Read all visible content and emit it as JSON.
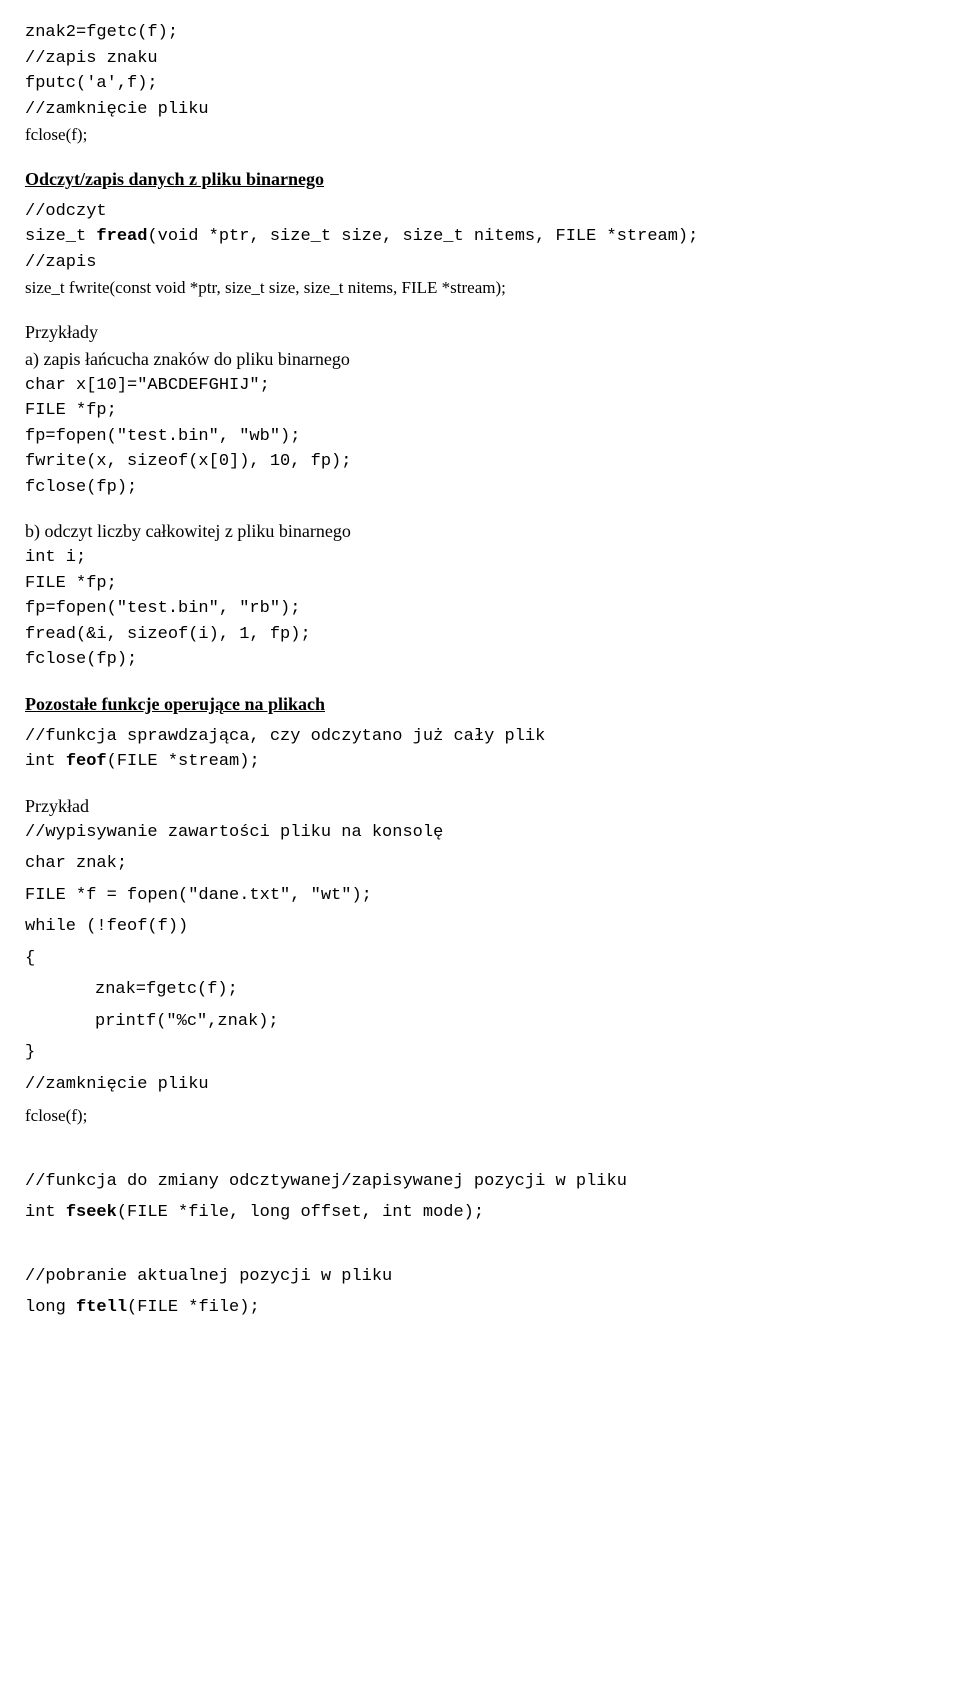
{
  "s1": {
    "l1": "znak2=fgetc(f);",
    "l2": "//zapis znaku",
    "l3": "fputc('a',f);",
    "l4": "//zamknięcie pliku",
    "l5": "fclose(f);"
  },
  "h1": "Odczyt/zapis danych z pliku binarnego",
  "s2": {
    "l1": "//odczyt",
    "l2": "size_t fread(void *ptr, size_t size, size_t nitems, FILE *stream);",
    "l3": "//zapis",
    "l4": "size_t fwrite(const void *ptr, size_t size, size_t nitems, FILE *stream);"
  },
  "ex_label": "Przykłady",
  "exa": {
    "title": "a) zapis łańcucha znaków do pliku binarnego",
    "l1": "char x[10]=\"ABCDEFGHIJ\";",
    "l2": "FILE *fp;",
    "l3": "fp=fopen(\"test.bin\", \"wb\");",
    "l4": "fwrite(x, sizeof(x[0]), 10, fp);",
    "l5": "fclose(fp);"
  },
  "exb": {
    "title": "b) odczyt liczby całkowitej z pliku binarnego",
    "l1": "int i;",
    "l2": "FILE *fp;",
    "l3": "fp=fopen(\"test.bin\", \"rb\");",
    "l4": "fread(&i, sizeof(i), 1, fp);",
    "l5": "fclose(fp);"
  },
  "h2": "Pozostałe funkcje operujące na plikach",
  "s3": {
    "l1": "//funkcja sprawdzająca, czy odczytano już cały plik",
    "l2": "int feof(FILE *stream);"
  },
  "ex2_label": "Przykład",
  "s4": {
    "l1": "//wypisywanie zawartości pliku na konsolę",
    "l2": "char znak;",
    "l3": "FILE *f = fopen(\"dane.txt\", \"wt\");",
    "l4": "while (!feof(f))",
    "l5": "{",
    "l6": "znak=fgetc(f);",
    "l7": "printf(\"%c\",znak);",
    "l8": "}",
    "l9": "//zamknięcie pliku",
    "l10": "fclose(f);"
  },
  "s5": {
    "l1": "//funkcja do zmiany odcztywanej/zapisywanej pozycji w pliku",
    "l2": "int fseek(FILE *file, long offset, int mode);"
  },
  "s6": {
    "l1": "//pobranie aktualnej pozycji w pliku",
    "l2": "long ftell(FILE *file);"
  }
}
